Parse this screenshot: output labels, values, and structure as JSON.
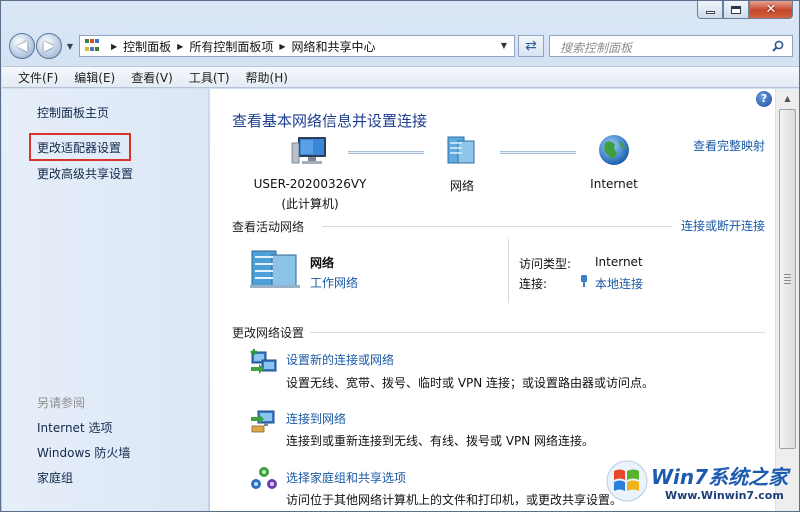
{
  "window": {
    "caption": {
      "minimize_icon": "minimize-icon",
      "maximize_icon": "maximize-icon",
      "close_icon": "close-icon",
      "close_glyph": "✕"
    }
  },
  "address_bar": {
    "breadcrumbs": [
      "控制面板",
      "所有控制面板项",
      "网络和共享中心"
    ],
    "search_placeholder": "搜索控制面板"
  },
  "menu": [
    "文件(F)",
    "编辑(E)",
    "查看(V)",
    "工具(T)",
    "帮助(H)"
  ],
  "left_pane": {
    "links": [
      "控制面板主页",
      "更改适配器设置",
      "更改高级共享设置"
    ],
    "highlighted": "更改适配器设置",
    "see_also_title": "另请参阅",
    "see_also": [
      "Internet 选项",
      "Windows 防火墙",
      "家庭组"
    ]
  },
  "main": {
    "title": "查看基本网络信息并设置连接",
    "full_map_link": "查看完整映射",
    "map": {
      "computer": {
        "label": "USER-20200326VY",
        "sub": "(此计算机)"
      },
      "network": {
        "label": "网络"
      },
      "internet": {
        "label": "Internet"
      }
    },
    "active": {
      "heading": "查看活动网络",
      "connect_link": "连接或断开连接",
      "network_name": "网络",
      "network_type": "工作网络",
      "access_type_label": "访问类型:",
      "access_type_value": "Internet",
      "connection_label": "连接:",
      "connection_value": "本地连接"
    },
    "change": {
      "heading": "更改网络设置",
      "tasks": [
        {
          "title": "设置新的连接或网络",
          "desc": "设置无线、宽带、拨号、临时或 VPN 连接；或设置路由器或访问点。"
        },
        {
          "title": "连接到网络",
          "desc": "连接到或重新连接到无线、有线、拨号或 VPN 网络连接。"
        },
        {
          "title": "选择家庭组和共享选项",
          "desc": "访问位于其他网络计算机上的文件和打印机，或更改共享设置。"
        }
      ]
    }
  },
  "watermark": {
    "main": "Win7系统之家",
    "url": "Www.Winwin7.com"
  },
  "colors": {
    "link": "#1a5aa6",
    "title": "#1e3f8e",
    "highlight_box": "#d9342b",
    "left_pane": "#e1eaf8"
  }
}
